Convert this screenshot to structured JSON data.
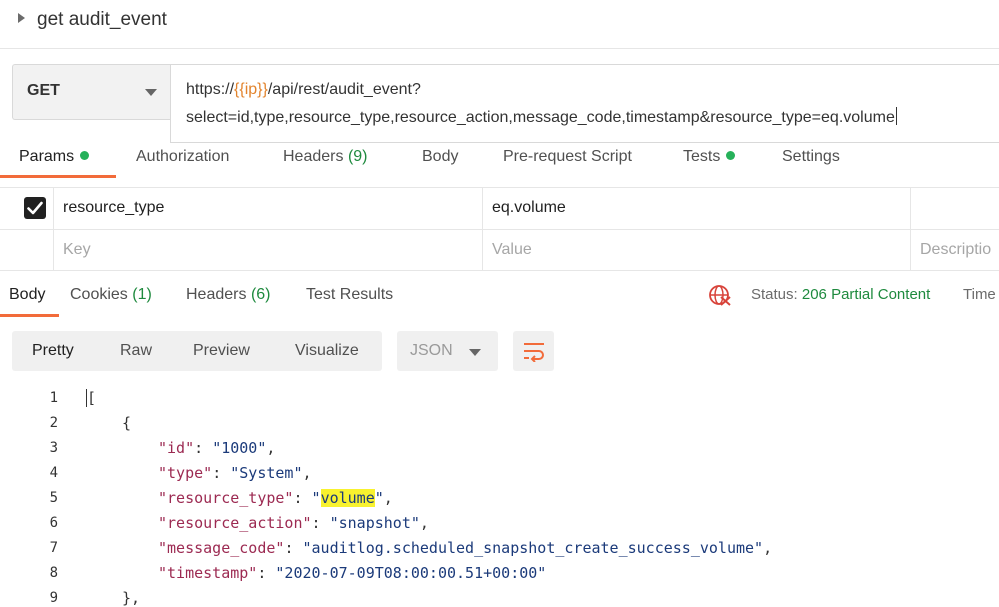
{
  "request": {
    "title": "get audit_event",
    "method": "GET",
    "url_prefix": "https://",
    "url_variable": "{{ip}}",
    "url_path": "/api/rest/audit_event?",
    "url_line2": "select=id,type,resource_type,resource_action,message_code,timestamp&resource_type=eq.volume"
  },
  "request_tabs": {
    "params": "Params",
    "authorization": "Authorization",
    "headers": "Headers",
    "headers_count": "(9)",
    "body": "Body",
    "prerequest": "Pre-request Script",
    "tests": "Tests",
    "settings": "Settings"
  },
  "params_table": {
    "row": {
      "checked": true,
      "key": "resource_type",
      "value": "eq.volume"
    },
    "key_placeholder": "Key",
    "value_placeholder": "Value",
    "description_placeholder": "Descriptio"
  },
  "response_tabs": {
    "body": "Body",
    "cookies": "Cookies",
    "cookies_count": "(1)",
    "headers": "Headers",
    "headers_count": "(6)",
    "test_results": "Test Results"
  },
  "response_status": {
    "label": "Status:",
    "value": "206 Partial Content",
    "time_label": "Time"
  },
  "view_modes": {
    "pretty": "Pretty",
    "raw": "Raw",
    "preview": "Preview",
    "visualize": "Visualize",
    "format": "JSON"
  },
  "code": {
    "line_numbers": [
      "1",
      "2",
      "3",
      "4",
      "5",
      "6",
      "7",
      "8",
      "9"
    ],
    "l1": "[",
    "l2": "{",
    "l3_key": "\"id\"",
    "l3_val": "\"1000\"",
    "l4_key": "\"type\"",
    "l4_val": "\"System\"",
    "l5_key": "\"resource_type\"",
    "l5_q": "\"",
    "l5_val": "volume",
    "l6_key": "\"resource_action\"",
    "l6_val": "\"snapshot\"",
    "l7_key": "\"message_code\"",
    "l7_val": "\"auditlog.scheduled_snapshot_create_success_volume\"",
    "l8_key": "\"timestamp\"",
    "l8_val": "\"2020-07-09T08:00:00.51+00:00\"",
    "l9": "},"
  },
  "colors": {
    "accent": "#f26b3a",
    "success": "#1e8a3e",
    "variable": "#e2832c",
    "highlight": "#f8f22f"
  },
  "icons": {
    "caret": "caret-right-icon",
    "dropdown": "chevron-down-icon",
    "checkbox": "checkbox-checked-icon",
    "globe": "globe-icon",
    "wrap": "wrap-lines-icon"
  }
}
